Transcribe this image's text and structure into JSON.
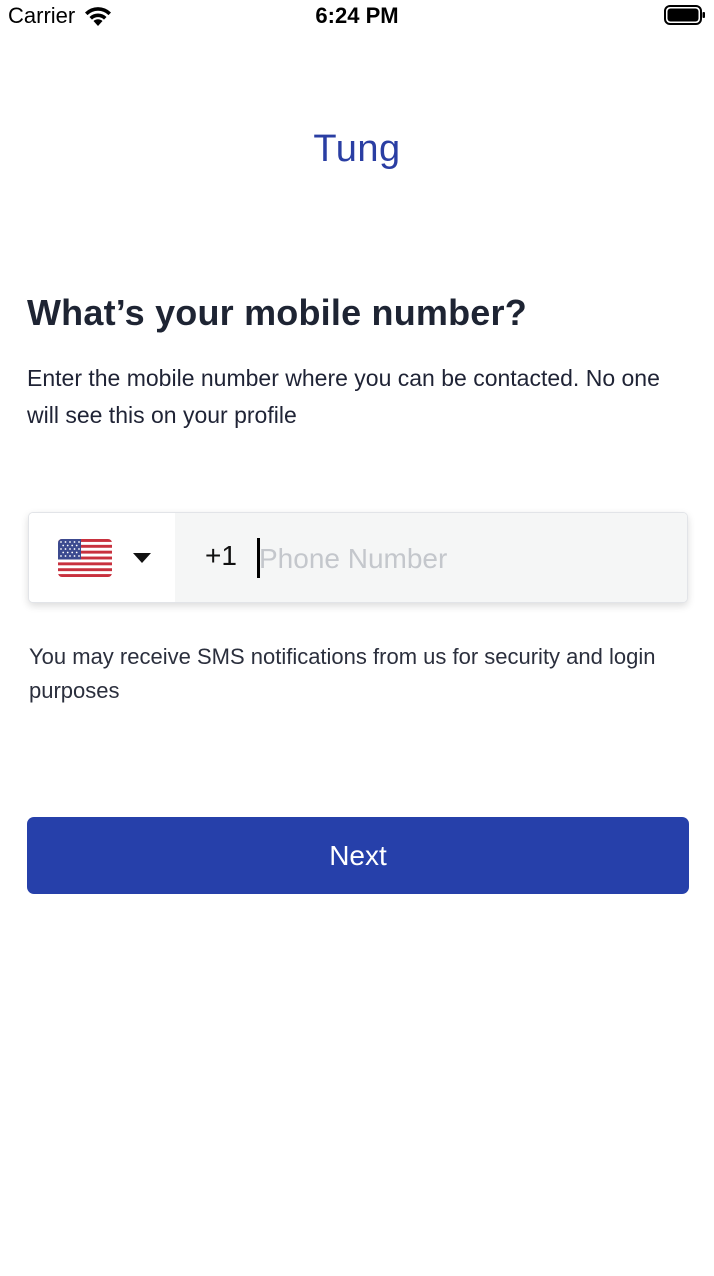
{
  "status_bar": {
    "carrier": "Carrier",
    "time": "6:24 PM",
    "icons": [
      "wifi-icon",
      "battery-icon"
    ]
  },
  "app": {
    "title": "Tung",
    "accent_color": "#2a3ea3"
  },
  "form": {
    "heading": "What’s your mobile number?",
    "subtitle": "Enter the mobile number where you can be contacted. No one will see this on your profile",
    "country": {
      "flag": "us-flag-icon",
      "dial_code": "+1"
    },
    "phone": {
      "value": "",
      "placeholder": "Phone Number"
    },
    "notice": "You may receive SMS notifications from us for security and login purposes",
    "next_label": "Next",
    "next_color": "#2640aa"
  }
}
